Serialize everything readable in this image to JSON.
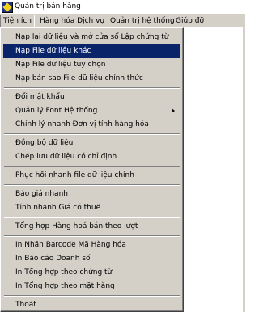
{
  "window": {
    "title": "Quản trị bán hàng"
  },
  "menubar": {
    "items": [
      {
        "label": "Tiện ích"
      },
      {
        "label": "Hàng hóa Dịch vụ"
      },
      {
        "label": "Quản trị hệ thống"
      },
      {
        "label": "Giúp đỡ"
      }
    ]
  },
  "dropdown": {
    "items": [
      {
        "label": "Nạp lại dữ liệu và mở cửa sổ Lập chứng từ"
      },
      {
        "label": "Nạp File dữ liệu khác"
      },
      {
        "label": "Nạp File dữ liệu tuỳ chọn"
      },
      {
        "label": "Nạp bản sao File dữ liệu chính thức"
      },
      {
        "label": "Đổi mật khẩu"
      },
      {
        "label": "Quản lý Font Hệ thống"
      },
      {
        "label": "Chỉnh lý nhanh Đơn vị tính hàng hóa"
      },
      {
        "label": "Đồng bộ dữ liệu"
      },
      {
        "label": "Chép lưu dữ liệu có chỉ định"
      },
      {
        "label": "Phục hồi nhanh file dữ liệu chính"
      },
      {
        "label": "Báo giá nhanh"
      },
      {
        "label": "Tính nhanh Giá có thuế"
      },
      {
        "label": "Tổng hợp Hàng hoá bán theo lượt"
      },
      {
        "label": "In Nhãn Barcode Mã Hàng hóa"
      },
      {
        "label": "In Báo cáo Doanh số"
      },
      {
        "label": "In Tổng hợp theo chứng từ"
      },
      {
        "label": "In Tổng hợp theo mặt hàng"
      },
      {
        "label": "Thoát"
      }
    ]
  },
  "colors": {
    "highlight": "#0a246a",
    "menu_face": "#d4d0c8"
  }
}
